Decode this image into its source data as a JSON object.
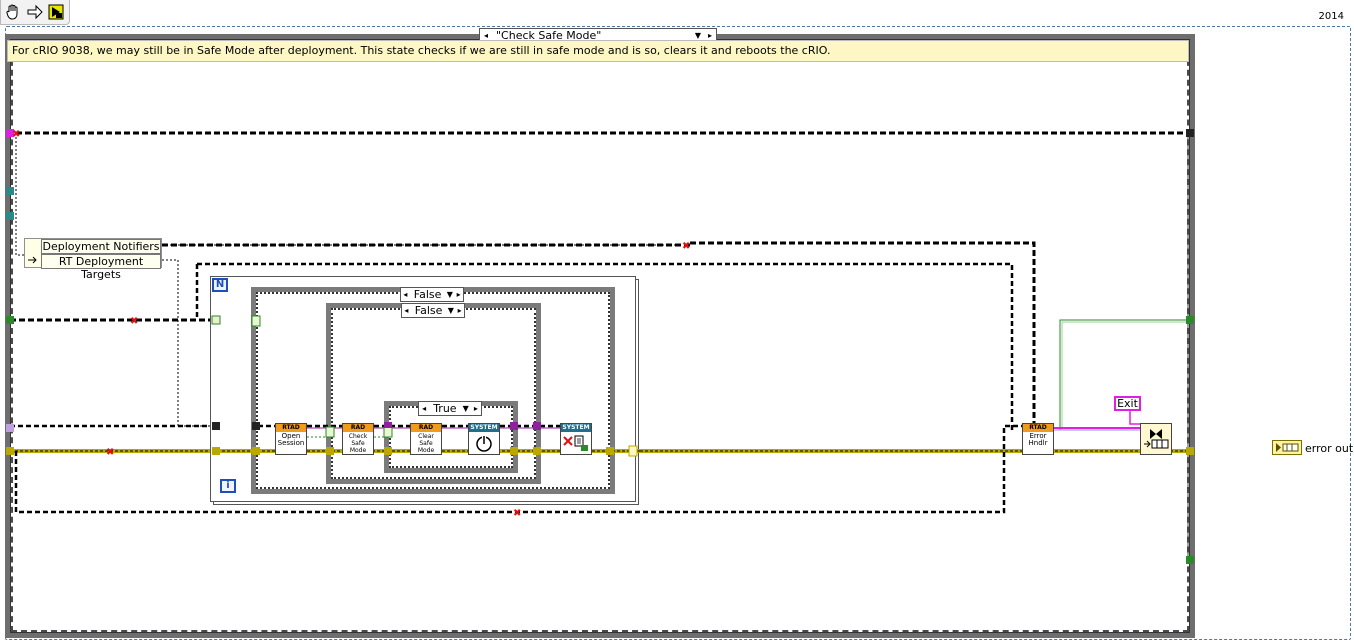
{
  "toolbar": {
    "icons": [
      "hand-icon",
      "arrow-right-icon",
      "run-vi-icon"
    ]
  },
  "while_loop": {
    "year_label": "2014"
  },
  "case_structure": {
    "selector_value": "\"Check Safe Mode\"",
    "comment": "For cRIO 9038, we may still be in Safe Mode after deployment. This state checks if we are still in safe mode and is so, clears it and reboots the cRIO."
  },
  "bundle": {
    "fields": [
      "Deployment Notifiers",
      "RT Deployment Targets"
    ]
  },
  "for_loop": {
    "count_label": "N",
    "index_label": "i"
  },
  "case_false_outer": {
    "selector_value": "False"
  },
  "case_false_inner": {
    "selector_value": "False"
  },
  "case_true": {
    "selector_value": "True"
  },
  "subvis": {
    "open_session": {
      "header": "RTAD",
      "label": "Open Session"
    },
    "check_safe_mode": {
      "header": "RAD",
      "label": "Check Safe Mode"
    },
    "clear_safe_mode": {
      "header": "RAD",
      "label": "Clear Safe Mode"
    },
    "reboot": {
      "header": "SYSTEM",
      "label": ""
    },
    "close_session": {
      "header": "SYSTEM",
      "label": ""
    },
    "error_handler": {
      "header": "RTAD",
      "label": "Error Hndlr"
    }
  },
  "exit_constant": {
    "label": "Exit"
  },
  "error_out": {
    "label": "error out"
  },
  "colors": {
    "error_wire": "#b8a800",
    "ref_wire": "#000000",
    "enum_wire": "#1a7a1a",
    "string_wire": "#e020e0",
    "blue_structure": "#1d4fb8"
  }
}
